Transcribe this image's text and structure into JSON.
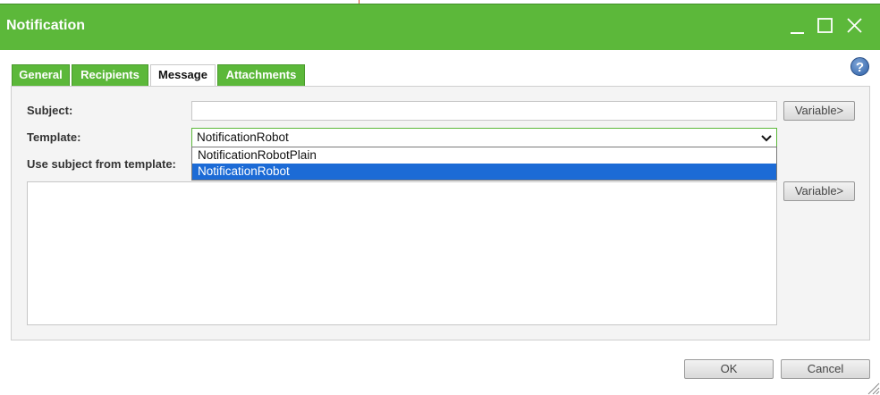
{
  "window": {
    "title": "Notification",
    "minimize_glyph": "minimize-icon",
    "maximize_glyph": "maximize-icon",
    "close_glyph": "close-icon"
  },
  "tabs": [
    {
      "label": "General",
      "active": false
    },
    {
      "label": "Recipients",
      "active": false
    },
    {
      "label": "Message",
      "active": true
    },
    {
      "label": "Attachments",
      "active": false
    }
  ],
  "form": {
    "subject_label": "Subject:",
    "subject_value": "",
    "template_label": "Template:",
    "template_selected": "NotificationRobot",
    "template_options": [
      {
        "label": "NotificationRobotPlain",
        "highlighted": false
      },
      {
        "label": "NotificationRobot",
        "highlighted": true
      }
    ],
    "use_subject_label": "Use subject from template:",
    "variable_button_label": "Variable>",
    "body_value": ""
  },
  "footer": {
    "ok_label": "OK",
    "cancel_label": "Cancel"
  },
  "help": {
    "glyph": "?"
  },
  "colors": {
    "accent": "#5cb83a",
    "selection": "#1c6bd6"
  }
}
